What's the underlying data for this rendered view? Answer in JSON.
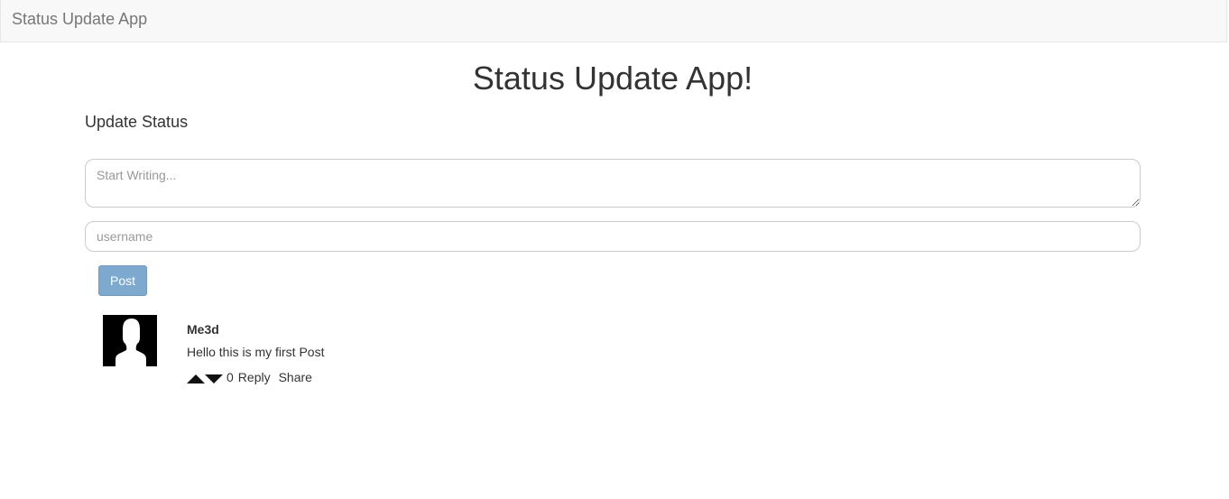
{
  "navbar": {
    "brand": "Status Update App"
  },
  "main": {
    "title": "Status Update App!",
    "section_title": "Update Status",
    "status_placeholder": "Start Writing...",
    "status_value": "",
    "username_placeholder": "username",
    "username_value": "",
    "post_label": "Post"
  },
  "posts": [
    {
      "author": "Me3d",
      "body": "Hello this is my first Post",
      "votes": "0",
      "reply_label": "Reply",
      "share_label": "Share",
      "avatar_icon": "user-silhouette-icon",
      "upvote_icon": "triangle-up-icon",
      "downvote_icon": "triangle-down-icon"
    }
  ],
  "colors": {
    "navbar_bg": "#f8f8f8",
    "brand_text": "#777777",
    "post_button": "#7ea9cf",
    "text": "#333333"
  }
}
